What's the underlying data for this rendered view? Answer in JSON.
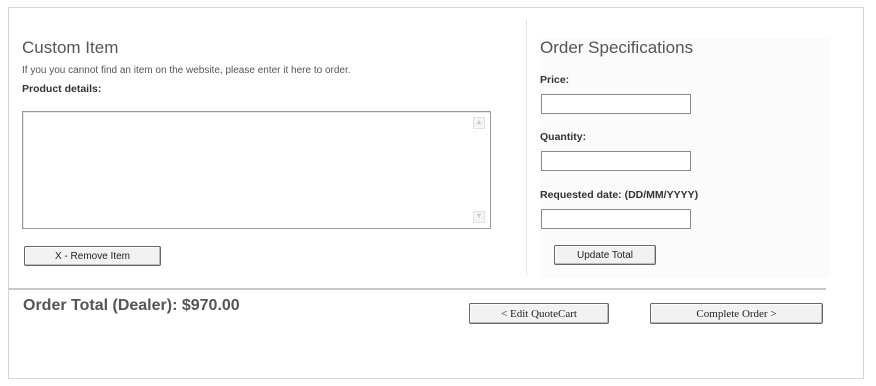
{
  "custom_item": {
    "title": "Custom Item",
    "hint": "If you you cannot find an item on the website, please enter it here to order.",
    "product_details_label": "Product details:",
    "product_details_value": "",
    "remove_button_label": "X - Remove Item"
  },
  "order_specs": {
    "title": "Order Specifications",
    "price_label": "Price:",
    "price_value": "",
    "quantity_label": "Quantity:",
    "quantity_value": "",
    "date_label": "Requested date: (DD/MM/YYYY)",
    "date_value": "",
    "update_button_label": "Update Total"
  },
  "footer": {
    "order_total": "Order Total (Dealer): $970.00",
    "edit_button_label": "< Edit QuoteCart",
    "complete_button_label": "Complete Order >"
  }
}
